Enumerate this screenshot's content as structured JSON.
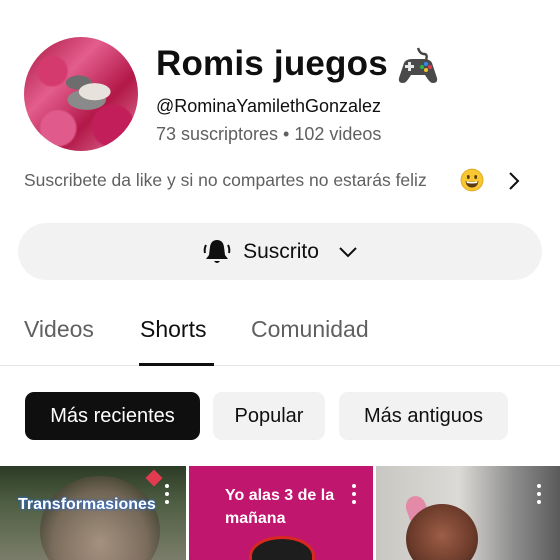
{
  "channel": {
    "name": "Romis juegos",
    "name_icon": "video-game-controller-icon",
    "handle": "@RominaYamilethGonzalez",
    "stats": "73 suscriptores • 102 videos",
    "description": "Suscribete da like y si no compartes no estarás feliz",
    "description_icon": "grinning-face-emoji-icon"
  },
  "subscribe": {
    "label": "Suscrito",
    "icon": "bell-ringing-icon"
  },
  "tabs": [
    {
      "label": "Videos",
      "active": false
    },
    {
      "label": "Shorts",
      "active": true
    },
    {
      "label": "Comunidad",
      "active": false
    }
  ],
  "filters": [
    {
      "label": "Más recientes",
      "active": true
    },
    {
      "label": "Popular",
      "active": false
    },
    {
      "label": "Más antiguos",
      "active": false
    }
  ],
  "shorts": [
    {
      "title": "Transformasiones"
    },
    {
      "title": "Yo alas 3 de la mañana"
    },
    {
      "title": ""
    }
  ],
  "colors": {
    "text_primary": "#0f0f0f",
    "text_secondary": "#606060",
    "chip_bg": "#f2f2f2",
    "chip_active_bg": "#0f0f0f"
  }
}
